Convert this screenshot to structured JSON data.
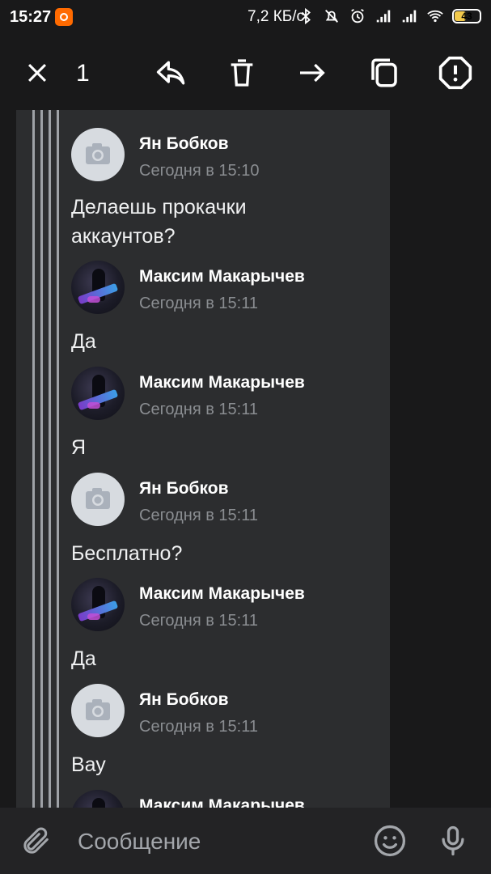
{
  "status_bar": {
    "time": "15:27",
    "speed": "7,2 КБ/с",
    "battery": "43",
    "icons": [
      "recording-icon",
      "bluetooth-icon",
      "mute-icon",
      "alarm-icon",
      "signal-icon",
      "signal-icon",
      "wifi-icon",
      "battery-icon"
    ]
  },
  "toolbar": {
    "selected_count": "1",
    "actions": [
      "close-icon",
      "reply-icon",
      "delete-icon",
      "forward-icon",
      "copy-icon",
      "report-icon"
    ]
  },
  "messages": [
    {
      "author": "Ян Бобков",
      "time": "Сегодня в 15:10",
      "text": "Делаешь прокачки\nаккаунтов?",
      "avatar": "camera-placeholder"
    },
    {
      "author": "Максим Макарычев",
      "time": "Сегодня в 15:11",
      "text": "Да",
      "avatar": "photo"
    },
    {
      "author": "Максим Макарычев",
      "time": "Сегодня в 15:11",
      "text": "Я",
      "avatar": "photo"
    },
    {
      "author": "Ян Бобков",
      "time": "Сегодня в 15:11",
      "text": "Бесплатно?",
      "avatar": "camera-placeholder"
    },
    {
      "author": "Максим Макарычев",
      "time": "Сегодня в 15:11",
      "text": "Да",
      "avatar": "photo"
    },
    {
      "author": "Ян Бобков",
      "time": "Сегодня в 15:11",
      "text": "Вау",
      "avatar": "camera-placeholder"
    },
    {
      "author": "Максим Макарычев",
      "time": "",
      "text": "",
      "avatar": "photo"
    }
  ],
  "composer": {
    "placeholder": "Сообщение"
  },
  "colors": {
    "background": "#19191a",
    "panel": "#2c2d2f",
    "accent": "#ffffff",
    "muted": "#8a8d91"
  }
}
